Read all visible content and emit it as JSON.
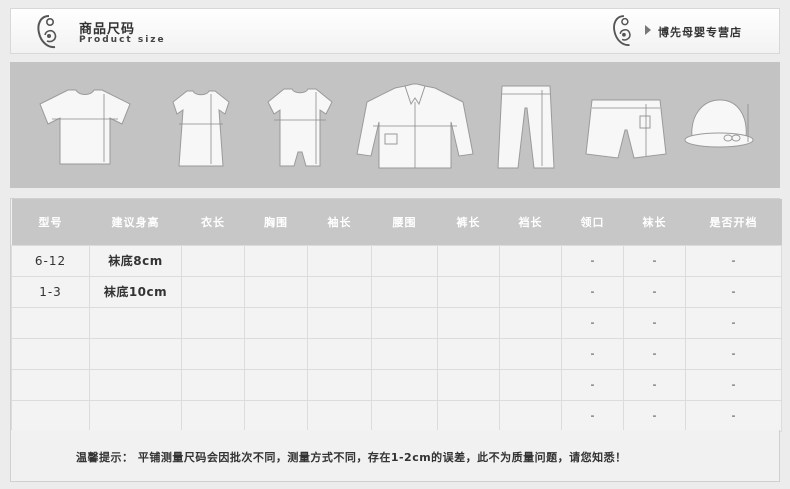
{
  "header": {
    "title_cn": "商品尺码",
    "title_en": "Product size",
    "store_name": "博先母婴专营店",
    "logo_icon": "mother-baby-logo-icon",
    "arrow_icon": "triangle-right-icon"
  },
  "garments": [
    "t-shirt-icon",
    "dress-icon",
    "romper-icon",
    "jacket-icon",
    "pants-icon",
    "shorts-icon",
    "hat-icon"
  ],
  "table": {
    "headers": [
      "型号",
      "建议身高",
      "衣长",
      "胸围",
      "袖长",
      "腰围",
      "裤长",
      "裆长",
      "领口",
      "袜长",
      "是否开档"
    ],
    "rows": [
      [
        "6-12",
        "袜底8cm",
        "",
        "",
        "",
        "",
        "",
        "",
        "-",
        "-",
        "-"
      ],
      [
        "1-3",
        "袜底10cm",
        "",
        "",
        "",
        "",
        "",
        "",
        "-",
        "-",
        "-"
      ],
      [
        "",
        "",
        "",
        "",
        "",
        "",
        "",
        "",
        "-",
        "-",
        "-"
      ],
      [
        "",
        "",
        "",
        "",
        "",
        "",
        "",
        "",
        "-",
        "-",
        "-"
      ],
      [
        "",
        "",
        "",
        "",
        "",
        "",
        "",
        "",
        "-",
        "-",
        "-"
      ],
      [
        "",
        "",
        "",
        "",
        "",
        "",
        "",
        "",
        "-",
        "-",
        "-"
      ]
    ]
  },
  "note": {
    "text": "温馨提示： 平铺测量尺码会因批次不同，测量方式不同，存在1-2cm的误差，此不为质量问题，请您知悉！"
  },
  "colors": {
    "band": "#c3c3c3",
    "header_row": "#c7c7c7",
    "cell_bg": "#f3f3f3",
    "page_bg": "#ececec"
  }
}
